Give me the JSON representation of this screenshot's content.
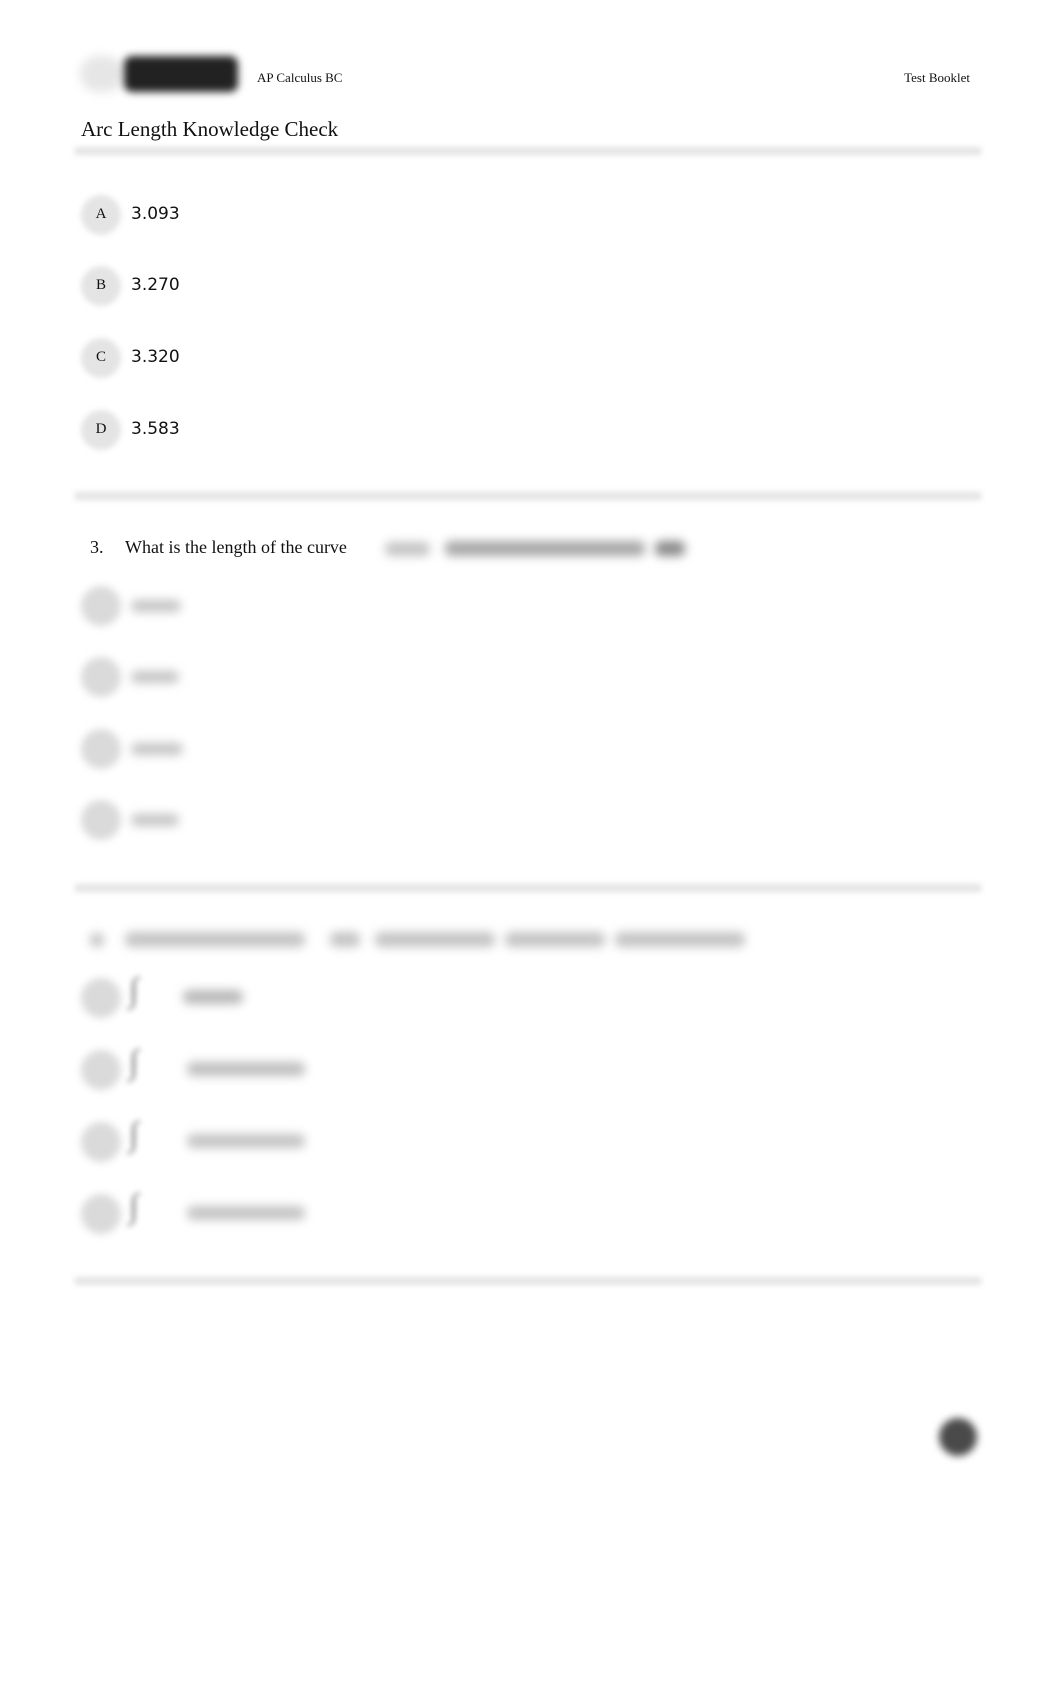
{
  "header": {
    "logo": "brand-logo",
    "course": "AP Calculus BC",
    "doc_type": "Test Booklet"
  },
  "page_title": "Arc Length Knowledge Check",
  "question_2": {
    "options": [
      {
        "letter": "A",
        "text": "3.093"
      },
      {
        "letter": "B",
        "text": "3.270"
      },
      {
        "letter": "C",
        "text": "3.320"
      },
      {
        "letter": "D",
        "text": "3.583"
      }
    ]
  },
  "question_3": {
    "number": "3.",
    "stem": "What is the length of the curve",
    "formula_obscured": true,
    "options_obscured": true
  },
  "question_4": {
    "number": "4.",
    "stem_obscured": true,
    "options_obscured": true,
    "option_icon": "integral-sign"
  },
  "floating_button": {
    "icon": "circle-button"
  }
}
